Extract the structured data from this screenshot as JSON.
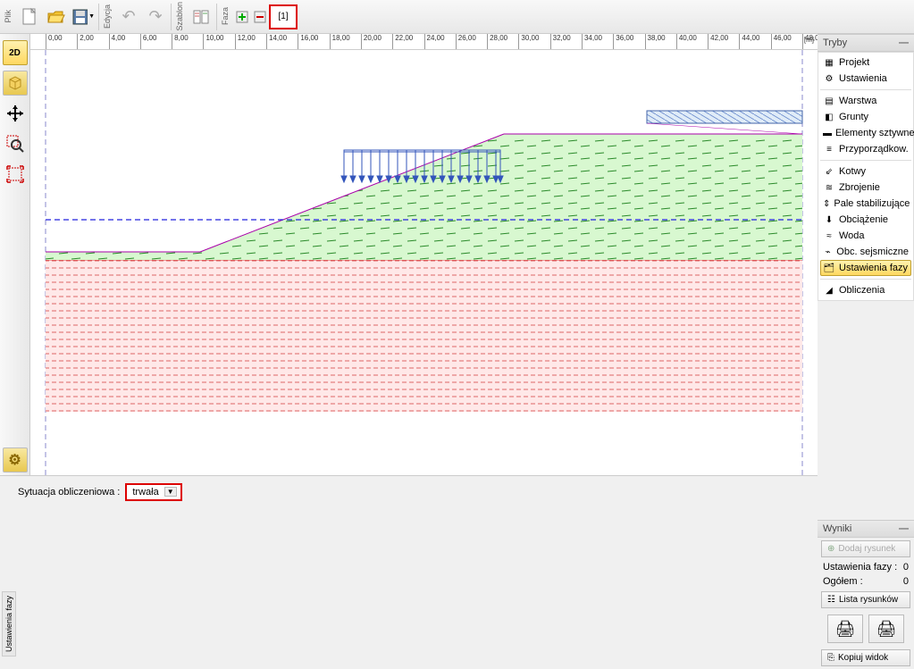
{
  "toolbar": {
    "file_label": "Plik",
    "edit_label": "Edycja",
    "template_label": "Szablon",
    "phase_label": "Faza",
    "phase_num": "[1]"
  },
  "ruler": {
    "unit": "[m]",
    "ticks": [
      0.0,
      2.0,
      4.0,
      6.0,
      8.0,
      10.0,
      12.0,
      14.0,
      16.0,
      18.0,
      20.0,
      22.0,
      24.0,
      26.0,
      28.0,
      30.0,
      32.0,
      34.0,
      36.0,
      38.0,
      40.0,
      42.0,
      44.0,
      46.0,
      48.0
    ]
  },
  "left_tools": {
    "view2d": "2D",
    "view3d": "3D"
  },
  "modes": {
    "header": "Tryby",
    "items": [
      {
        "label": "Projekt"
      },
      {
        "label": "Ustawienia"
      },
      {
        "sep": true
      },
      {
        "label": "Warstwa"
      },
      {
        "label": "Grunty"
      },
      {
        "label": "Elementy sztywne"
      },
      {
        "label": "Przyporządkow."
      },
      {
        "sep": true
      },
      {
        "label": "Kotwy"
      },
      {
        "label": "Zbrojenie"
      },
      {
        "label": "Pale stabilizujące"
      },
      {
        "label": "Obciążenie"
      },
      {
        "label": "Woda"
      },
      {
        "label": "Obc. sejsmiczne"
      },
      {
        "label": "Ustawienia fazy",
        "selected": true
      },
      {
        "sep": true
      },
      {
        "label": "Obliczenia"
      }
    ]
  },
  "bottom": {
    "tab": "Ustawienia fazy",
    "situation_label": "Sytuacja obliczeniowa :",
    "situation_value": "trwała"
  },
  "results": {
    "header": "Wyniki",
    "add_drawing": "Dodaj rysunek",
    "phase_settings": "Ustawienia fazy :",
    "phase_val": "0",
    "total": "Ogółem :",
    "total_val": "0",
    "list": "Lista rysunków",
    "copy_view": "Kopiuj widok"
  }
}
